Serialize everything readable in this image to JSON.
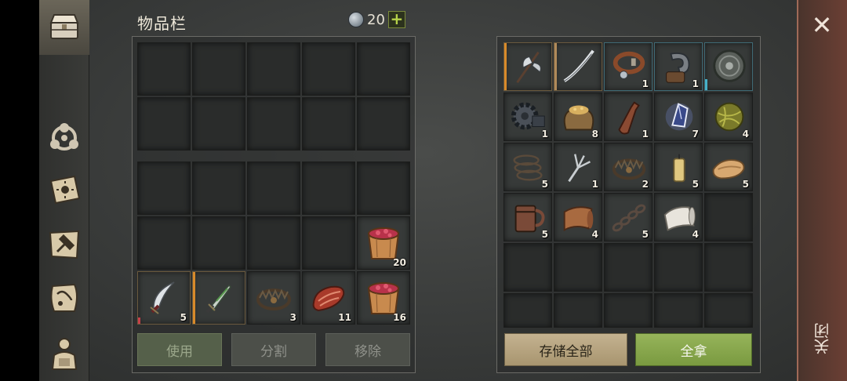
{
  "header": {
    "title": "物品栏",
    "currency_value": "20",
    "plus_label": "+"
  },
  "inventory_items": [
    {
      "name": "scimitar",
      "qty": "5"
    },
    {
      "name": "green-dagger",
      "qty": ""
    },
    {
      "name": "bear-trap",
      "qty": "3"
    },
    {
      "name": "raw-meat",
      "qty": "11"
    },
    {
      "name": "berry-bucket",
      "qty": "16"
    },
    {
      "name": "berry-bucket",
      "qty": "20"
    }
  ],
  "storage_items": [
    {
      "name": "halberd",
      "qty": ""
    },
    {
      "name": "scythe-blade",
      "qty": ""
    },
    {
      "name": "leather-collar",
      "qty": "1"
    },
    {
      "name": "iron-hook",
      "qty": "1"
    },
    {
      "name": "round-shield",
      "qty": ""
    },
    {
      "name": "gear-parts",
      "qty": "1"
    },
    {
      "name": "grain-sack",
      "qty": "8"
    },
    {
      "name": "flask",
      "qty": "1"
    },
    {
      "name": "crystal-shard",
      "qty": "7"
    },
    {
      "name": "herb-ball",
      "qty": "4"
    },
    {
      "name": "rope",
      "qty": "5"
    },
    {
      "name": "fork",
      "qty": "1"
    },
    {
      "name": "bear-trap",
      "qty": "2"
    },
    {
      "name": "candle",
      "qty": "5"
    },
    {
      "name": "folded-cloth",
      "qty": "5"
    },
    {
      "name": "wooden-mug",
      "qty": "5"
    },
    {
      "name": "leather-scroll",
      "qty": "4"
    },
    {
      "name": "chain",
      "qty": "5"
    },
    {
      "name": "paper-scroll",
      "qty": "4"
    }
  ],
  "buttons": {
    "use": "使用",
    "split": "分割",
    "remove": "移除",
    "store_all": "存储全部",
    "take_all": "全拿"
  },
  "close": {
    "x": "✕",
    "label": "关闭"
  },
  "colors": {
    "accent_green": "#8aa84e",
    "store_tan": "#b8a47e",
    "close_red": "#6b3f34"
  }
}
